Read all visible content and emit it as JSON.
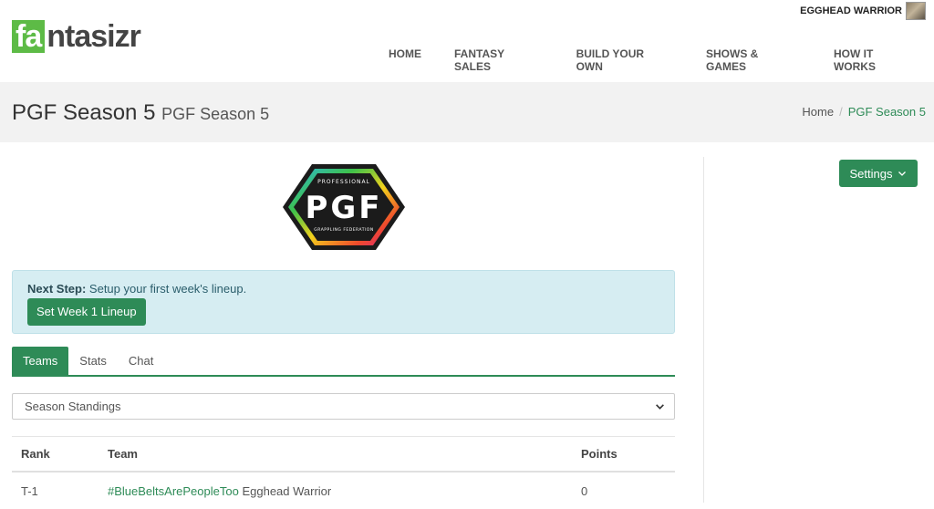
{
  "header": {
    "logo_box": "fa",
    "logo_rest": "ntasizr",
    "user_name": "EGGHEAD WARRIOR",
    "nav": [
      "HOME",
      "FANTASY SALES",
      "BUILD YOUR OWN",
      "SHOWS & GAMES",
      "HOW IT WORKS"
    ]
  },
  "title_band": {
    "title": "PGF Season 5",
    "subtitle": "PGF Season 5",
    "breadcrumb": [
      "Home",
      "PGF Season 5"
    ]
  },
  "sidebar": {
    "settings_label": "Settings"
  },
  "badge": {
    "top_text": "PROFESSIONAL",
    "main_text": "PGF",
    "bottom_text": "GRAPPLING FEDERATION"
  },
  "alert": {
    "label": "Next Step:",
    "text": "Setup your first week's lineup.",
    "button": "Set Week 1 Lineup"
  },
  "tabs": [
    "Teams",
    "Stats",
    "Chat"
  ],
  "select": {
    "value": "Season Standings"
  },
  "table": {
    "headers": [
      "Rank",
      "Team",
      "Points"
    ],
    "rows": [
      {
        "rank": "T-1",
        "team": "#BlueBeltsArePeopleToo",
        "owner": "Egghead Warrior",
        "points": "0"
      }
    ]
  }
}
